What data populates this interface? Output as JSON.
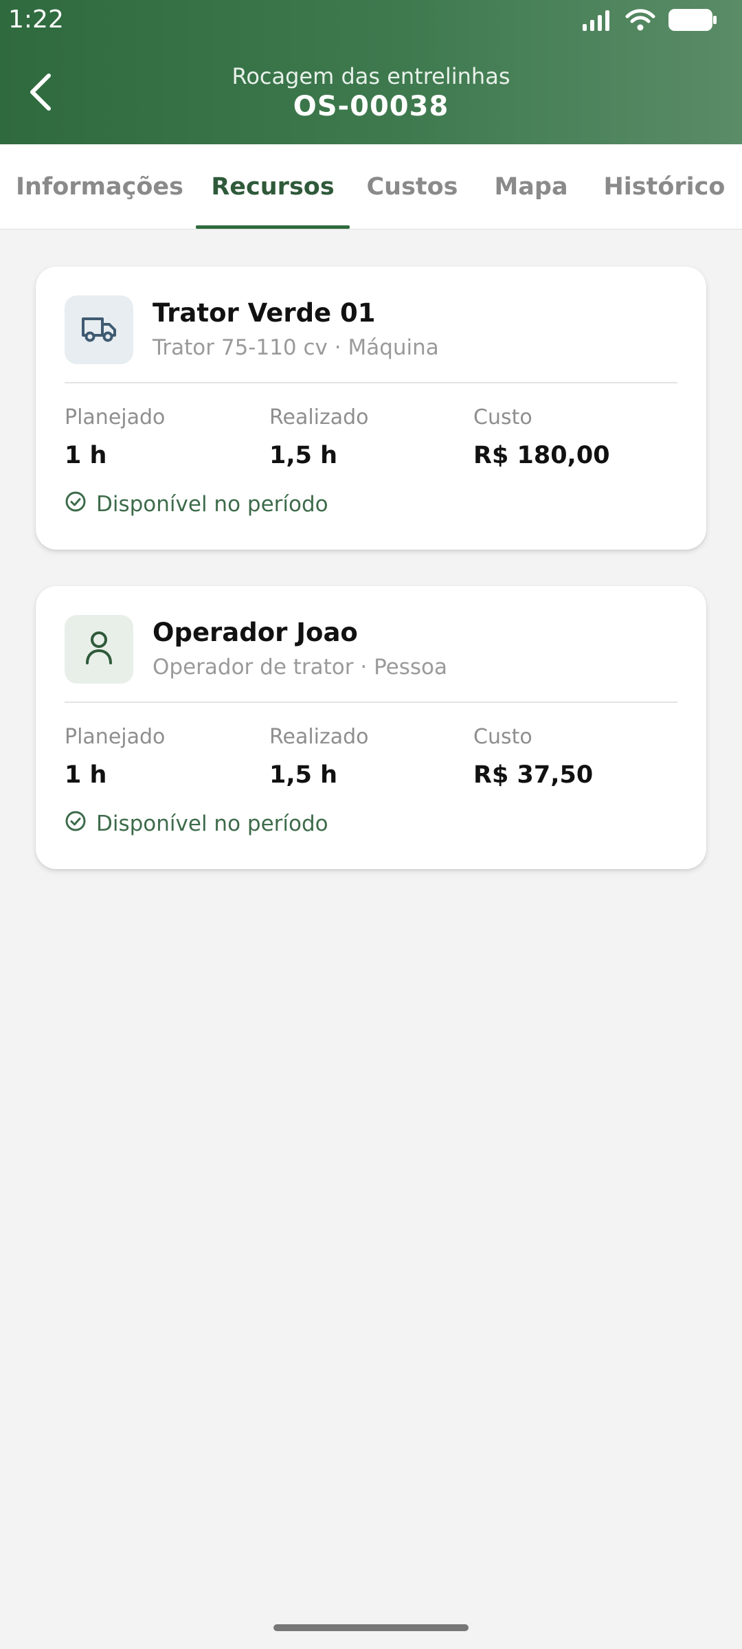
{
  "status_bar": {
    "time": "1:22",
    "icons": [
      "signal-icon",
      "wifi-icon",
      "battery-icon"
    ]
  },
  "header": {
    "subtitle": "Rocagem das entrelinhas",
    "title": "OS-00038",
    "back_icon": "chevron-left-icon"
  },
  "tabs": [
    {
      "label": "Informações",
      "active": false
    },
    {
      "label": "Recursos",
      "active": true
    },
    {
      "label": "Custos",
      "active": false
    },
    {
      "label": "Mapa",
      "active": false
    },
    {
      "label": "Histórico",
      "active": false
    }
  ],
  "resources": [
    {
      "icon": "truck-icon",
      "name": "Trator Verde 01",
      "subtitle": "Trator 75-110 cv · Máquina",
      "planned_label": "Planejado",
      "planned_value": "1 h",
      "actual_label": "Realizado",
      "actual_value": "1,5 h",
      "cost_label": "Custo",
      "cost_value": "R$ 180,00",
      "availability": "Disponível no período"
    },
    {
      "icon": "person-icon",
      "name": "Operador Joao",
      "subtitle": "Operador de trator · Pessoa",
      "planned_label": "Planejado",
      "planned_value": "1 h",
      "actual_label": "Realizado",
      "actual_value": "1,5 h",
      "cost_label": "Custo",
      "cost_value": "R$ 37,50",
      "availability": "Disponível no período"
    }
  ],
  "colors": {
    "header_green": "#2f6a3e",
    "active_tab": "#2f5a3a",
    "availability_green": "#3d6b4a"
  }
}
